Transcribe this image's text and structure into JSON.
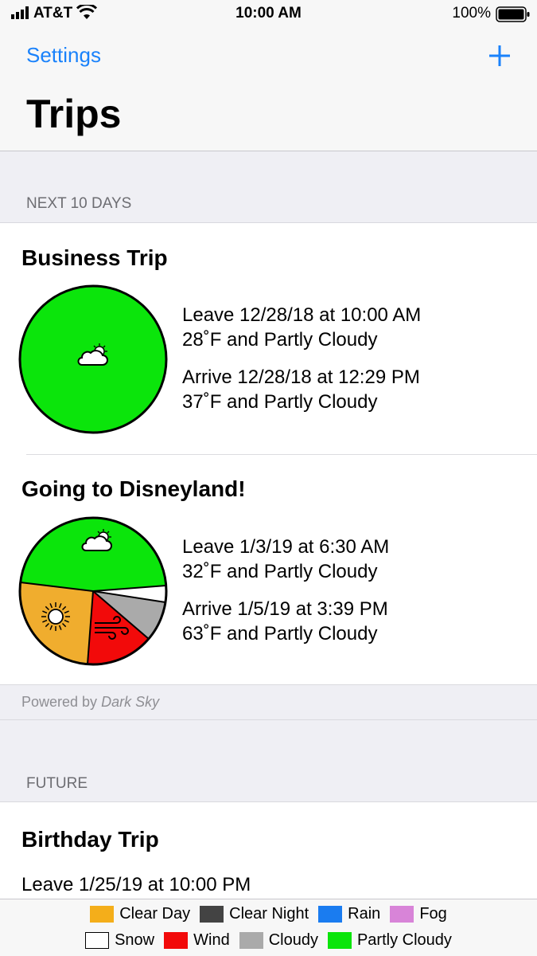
{
  "status_bar": {
    "carrier": "AT&T",
    "time": "10:00 AM",
    "battery": "100%"
  },
  "nav": {
    "back_label": "Settings",
    "title": "Trips"
  },
  "sections": {
    "next": {
      "header": "NEXT 10 DAYS"
    },
    "future": {
      "header": "FUTURE"
    }
  },
  "trips": [
    {
      "title": "Business Trip",
      "leave": "Leave 12/28/18 at 10:00 AM",
      "leave_weather": "28˚F and Partly Cloudy",
      "arrive": "Arrive 12/28/18 at 12:29 PM",
      "arrive_weather": "37˚F and Partly Cloudy"
    },
    {
      "title": "Going to Disneyland!",
      "leave": "Leave 1/3/19 at 6:30 AM",
      "leave_weather": "32˚F and Partly Cloudy",
      "arrive": "Arrive 1/5/19 at 3:39 PM",
      "arrive_weather": "63˚F and Partly Cloudy"
    },
    {
      "title": "Birthday Trip",
      "leave": "Leave 1/25/19 at 10:00 PM"
    }
  ],
  "powered_by": {
    "prefix": "Powered by",
    "brand": "Dark Sky"
  },
  "legend": {
    "row1": [
      {
        "label": "Clear Day",
        "color": "#f4ae1a"
      },
      {
        "label": "Clear Night",
        "color": "#434343"
      },
      {
        "label": "Rain",
        "color": "#1a7cf0"
      },
      {
        "label": "Fog",
        "color": "#d884d8"
      }
    ],
    "row2": [
      {
        "label": "Snow",
        "color": "#ffffff"
      },
      {
        "label": "Wind",
        "color": "#f20a0a"
      },
      {
        "label": "Cloudy",
        "color": "#aaaaaa"
      },
      {
        "label": "Partly Cloudy",
        "color": "#0be50b"
      }
    ]
  },
  "colors": {
    "accent": "#1a82fb",
    "partly_cloudy": "#0be50b",
    "clear_day": "#f0ad2e",
    "wind": "#f20a0a",
    "cloudy": "#aaaaaa",
    "snow": "#ffffff"
  }
}
